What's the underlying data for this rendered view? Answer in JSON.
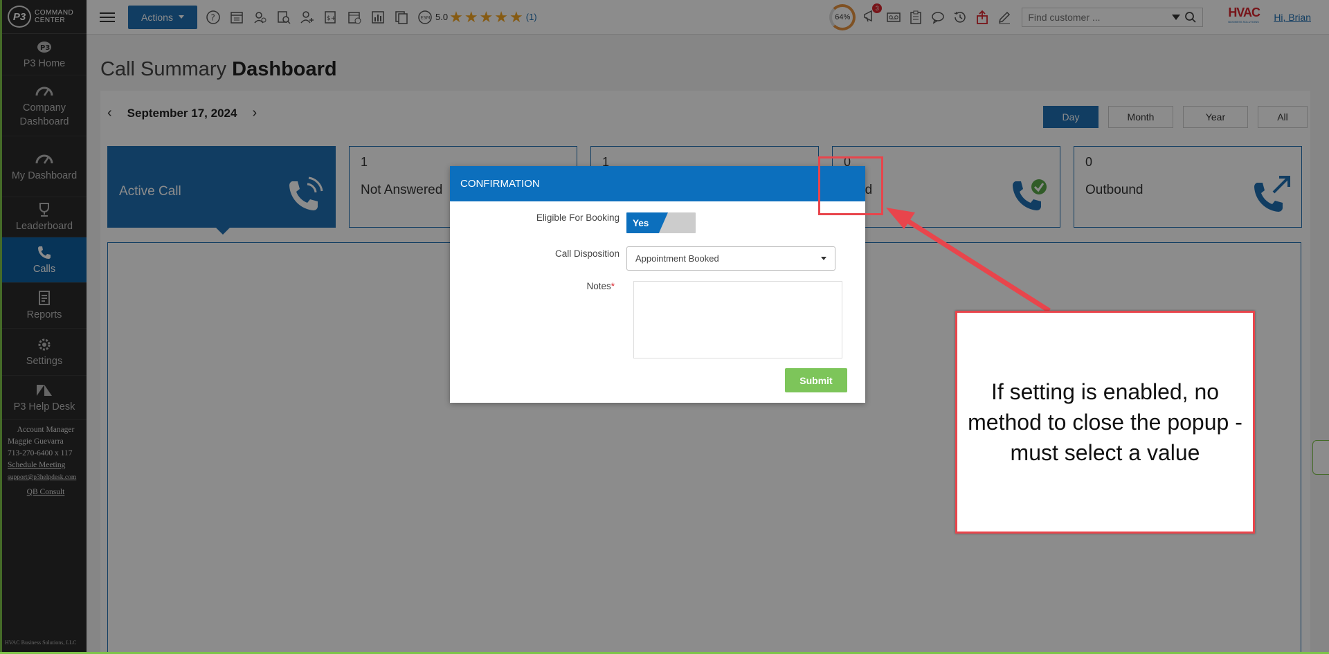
{
  "brand": {
    "logo_text": "P3",
    "line1": "COMMAND",
    "line2": "CENTER"
  },
  "sidebar": {
    "items": [
      {
        "label": "P3 Home",
        "icon": "p3-home-icon"
      },
      {
        "label": "Company Dashboard",
        "icon": "gauge-icon"
      },
      {
        "label": "My Dashboard",
        "icon": "gauge-icon"
      },
      {
        "label": "Leaderboard",
        "icon": "trophy-icon"
      },
      {
        "label": "Calls",
        "icon": "phone-icon",
        "active": true
      },
      {
        "label": "Reports",
        "icon": "report-icon"
      },
      {
        "label": "Settings",
        "icon": "gear-icon"
      },
      {
        "label": "P3 Help Desk",
        "icon": "zendesk-icon"
      }
    ],
    "account": {
      "title": "Account Manager",
      "name": "Maggie Guevarra",
      "phone": "713-270-6400 x 117",
      "schedule": "Schedule Meeting",
      "email": "support@p3helpdesk.com",
      "qb": "QB Consult"
    },
    "copyright": "HVAC Business Solutions, LLC"
  },
  "topbar": {
    "actions_label": "Actions",
    "esm_label": "ESM",
    "rating_value": "5.0",
    "rating_count": "(1)",
    "progress_percent": "64%",
    "notification_count": "3",
    "search_placeholder": "Find customer ...",
    "hvac_logo_main": "HVAC",
    "hvac_logo_sub": "BUSINESS SOLUTIONS",
    "greeting": "Hi, Brian"
  },
  "page": {
    "title_light": "Call Summary",
    "title_bold": "Dashboard",
    "date": "September 17, 2024",
    "periods": [
      "Day",
      "Month",
      "Year",
      "All"
    ],
    "active_period": "Day"
  },
  "cards": [
    {
      "count": "",
      "label": "Active Call"
    },
    {
      "count": "1",
      "label": "Not Answered"
    },
    {
      "count": "1",
      "label": ""
    },
    {
      "count": "0",
      "label": "oked"
    },
    {
      "count": "0",
      "label": "Outbound"
    }
  ],
  "modal": {
    "title": "CONFIRMATION",
    "eligible_label": "Eligible For Booking",
    "toggle_value": "Yes",
    "disposition_label": "Call Disposition",
    "disposition_value": "Appointment Booked",
    "notes_label": "Notes",
    "notes_required_mark": "*",
    "submit_label": "Submit"
  },
  "annotation": {
    "text": "If setting is enabled, no method to close the popup - must select a value",
    "color": "#e8454c"
  },
  "colors": {
    "primary": "#1f6fb2",
    "header": "#0c6fbd",
    "submit": "#7dc55a",
    "accent": "#7ec34a"
  }
}
